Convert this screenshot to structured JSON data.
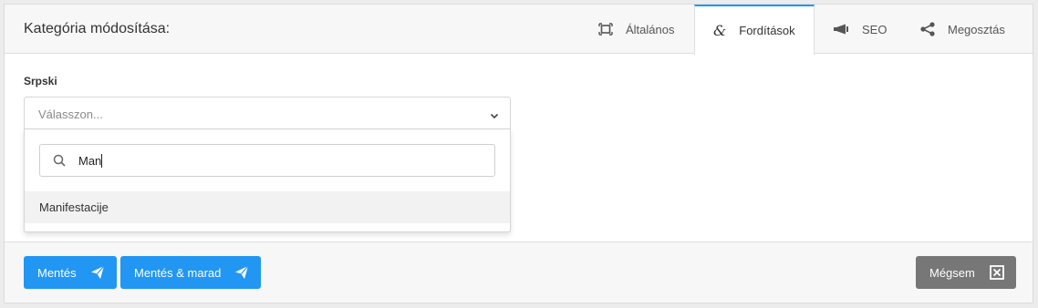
{
  "header": {
    "title": "Kategória módosítása:",
    "tabs": [
      {
        "label": "Általános",
        "icon": "frame-icon",
        "active": false
      },
      {
        "label": "Fordítások",
        "icon": "translate-icon",
        "active": true
      },
      {
        "label": "SEO",
        "icon": "megaphone-icon",
        "active": false
      },
      {
        "label": "Megosztás",
        "icon": "share-icon",
        "active": false
      }
    ]
  },
  "form": {
    "field_label": "Srpski",
    "select_placeholder": "Válasszon...",
    "search_value": "Man",
    "options": [
      "Manifestacije"
    ]
  },
  "footer": {
    "save_label": "Mentés",
    "save_stay_label": "Mentés & marad",
    "cancel_label": "Mégsem"
  },
  "colors": {
    "accent": "#2196f3",
    "secondary_button": "#777777"
  }
}
